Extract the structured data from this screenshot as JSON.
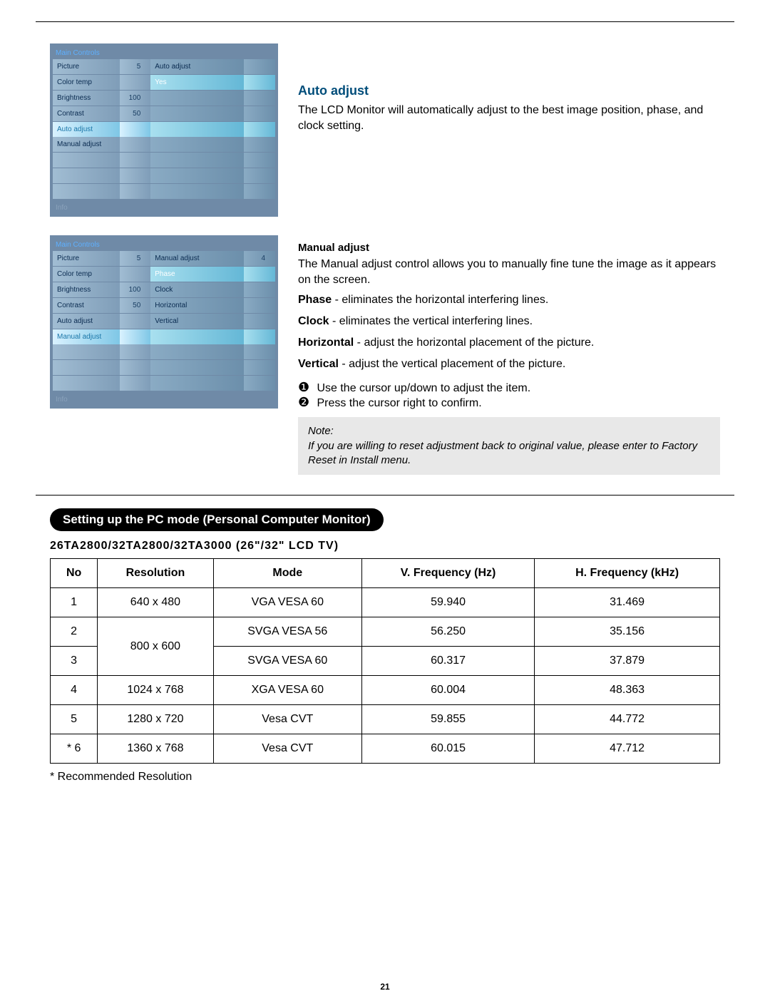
{
  "page_number": "21",
  "osd_auto": {
    "header": "Main Controls",
    "footer": "Info",
    "left": {
      "cols": [
        "name",
        "value"
      ],
      "rows": [
        {
          "name": "Picture",
          "value": "5"
        },
        {
          "name": "Color temp",
          "value": ""
        },
        {
          "name": "Brightness",
          "value": "100"
        },
        {
          "name": "Contrast",
          "value": "50"
        },
        {
          "name": "Auto adjust",
          "value": ""
        },
        {
          "name": "Manual adjust",
          "value": ""
        }
      ],
      "highlight_index": 4
    },
    "right": {
      "heading": "Auto adjust",
      "rows": [
        "Yes",
        "",
        "",
        "",
        "",
        "",
        "",
        ""
      ],
      "highlight_index": 0
    }
  },
  "osd_manual": {
    "header": "Main Controls",
    "footer": "Info",
    "left": {
      "rows": [
        {
          "name": "Picture",
          "value": "5"
        },
        {
          "name": "Color temp",
          "value": ""
        },
        {
          "name": "Brightness",
          "value": "100"
        },
        {
          "name": "Contrast",
          "value": "50"
        },
        {
          "name": "Auto adjust",
          "value": ""
        },
        {
          "name": "Manual adjust",
          "value": ""
        }
      ],
      "highlight_index": 5
    },
    "right": {
      "heading": "Manual adjust",
      "heading_value": "4",
      "rows": [
        "Phase",
        "Clock",
        "Horizontal",
        "Vertical",
        "",
        "",
        "",
        ""
      ],
      "highlight_index": 0
    }
  },
  "auto_adjust": {
    "title": "Auto adjust",
    "body": "The LCD Monitor will automatically adjust to the best image position, phase, and clock setting."
  },
  "manual_adjust": {
    "title": "Manual adjust",
    "intro": "The Manual adjust control allows you to manually fine tune the image as it appears on the screen.",
    "defs": [
      {
        "term": "Phase",
        "desc": " - eliminates the horizontal interfering lines."
      },
      {
        "term": "Clock",
        "desc": " - eliminates the vertical interfering lines."
      },
      {
        "term": "Horizontal",
        "desc": " - adjust the horizontal placement of the picture."
      },
      {
        "term": "Vertical",
        "desc": " - adjust the vertical placement of the picture."
      }
    ],
    "steps": [
      "Use the cursor up/down to adjust the item.",
      "Press the cursor right to confirm."
    ],
    "step_markers": [
      "❶",
      "❷"
    ]
  },
  "note": {
    "label": "Note:",
    "body": "If you are willing to reset adjustment back to original value, please enter to Factory Reset in Install menu."
  },
  "pc_mode": {
    "pill": "Setting up the PC mode (Personal Computer Monitor)",
    "model_line": "26TA2800/32TA2800/32TA3000 (26\"/32\" LCD TV)",
    "headers": [
      "No",
      "Resolution",
      "Mode",
      "V. Frequency (Hz)",
      "H. Frequency (kHz)"
    ],
    "rows": [
      {
        "no": "1",
        "res": "640 x 480",
        "mode": "VGA VESA 60",
        "vf": "59.940",
        "hf": "31.469"
      },
      {
        "no": "2",
        "res": "800 x 600",
        "mode": "SVGA VESA 56",
        "vf": "56.250",
        "hf": "35.156"
      },
      {
        "no": "3",
        "res": "800 x 600",
        "mode": "SVGA VESA 60",
        "vf": "60.317",
        "hf": "37.879"
      },
      {
        "no": "4",
        "res": "1024 x 768",
        "mode": "XGA  VESA  60",
        "vf": "60.004",
        "hf": "48.363"
      },
      {
        "no": "5",
        "res": "1280 x 720",
        "mode": "Vesa CVT",
        "vf": "59.855",
        "hf": "44.772"
      },
      {
        "no": "* 6",
        "res": "1360 x 768",
        "mode": "Vesa CVT",
        "vf": "60.015",
        "hf": "47.712"
      }
    ],
    "recommended": "* Recommended Resolution"
  },
  "chart_data": {
    "type": "table",
    "title": "PC display modes — 26TA2800/32TA2800/32TA3000",
    "columns": [
      "No",
      "Resolution",
      "Mode",
      "V. Frequency (Hz)",
      "H. Frequency (kHz)"
    ],
    "rows": [
      [
        "1",
        "640 x 480",
        "VGA VESA 60",
        59.94,
        31.469
      ],
      [
        "2",
        "800 x 600",
        "SVGA VESA 56",
        56.25,
        35.156
      ],
      [
        "3",
        "800 x 600",
        "SVGA VESA 60",
        60.317,
        37.879
      ],
      [
        "4",
        "1024 x 768",
        "XGA VESA 60",
        60.004,
        48.363
      ],
      [
        "5",
        "1280 x 720",
        "Vesa CVT",
        59.855,
        44.772
      ],
      [
        "6",
        "1360 x 768",
        "Vesa CVT",
        60.015,
        47.712
      ]
    ],
    "note": "Row 6 is the recommended resolution."
  }
}
